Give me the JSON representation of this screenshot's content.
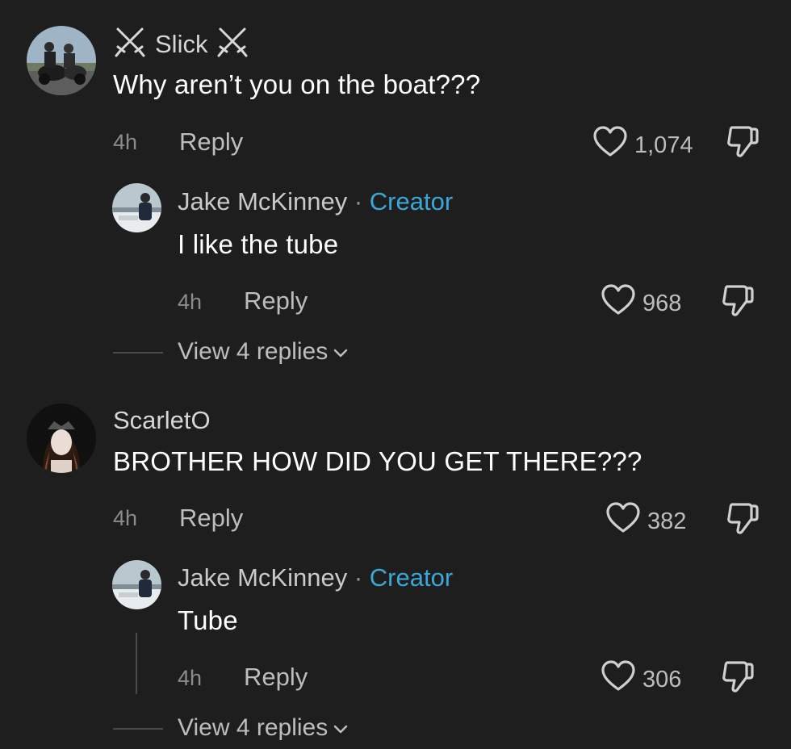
{
  "comments": [
    {
      "username": "Slick",
      "text": "Why aren’t you on the boat???",
      "time": "4h",
      "reply_label": "Reply",
      "likes": "1,074",
      "reply": {
        "username": "Jake McKinney",
        "separator": "·",
        "badge": "Creator",
        "text": "I like the tube",
        "time": "4h",
        "reply_label": "Reply",
        "likes": "968",
        "view_replies": "View 4 replies"
      }
    },
    {
      "username": "ScarletO",
      "text": "BROTHER HOW DID YOU GET THERE???",
      "time": "4h",
      "reply_label": "Reply",
      "likes": "382",
      "reply": {
        "username": "Jake McKinney",
        "separator": "·",
        "badge": "Creator",
        "text": "Tube",
        "time": "4h",
        "reply_label": "Reply",
        "likes": "306",
        "view_replies": "View 4 replies"
      }
    }
  ],
  "icons": {
    "username_decoration": "crossed-swords-icon",
    "like": "heart-outline-icon",
    "dislike": "thumbs-down-outline-icon",
    "expand": "chevron-down-icon"
  },
  "colors": {
    "background": "#1e1e1e",
    "creator_badge": "#3aa7d6",
    "secondary_text": "#bdbdbd"
  }
}
